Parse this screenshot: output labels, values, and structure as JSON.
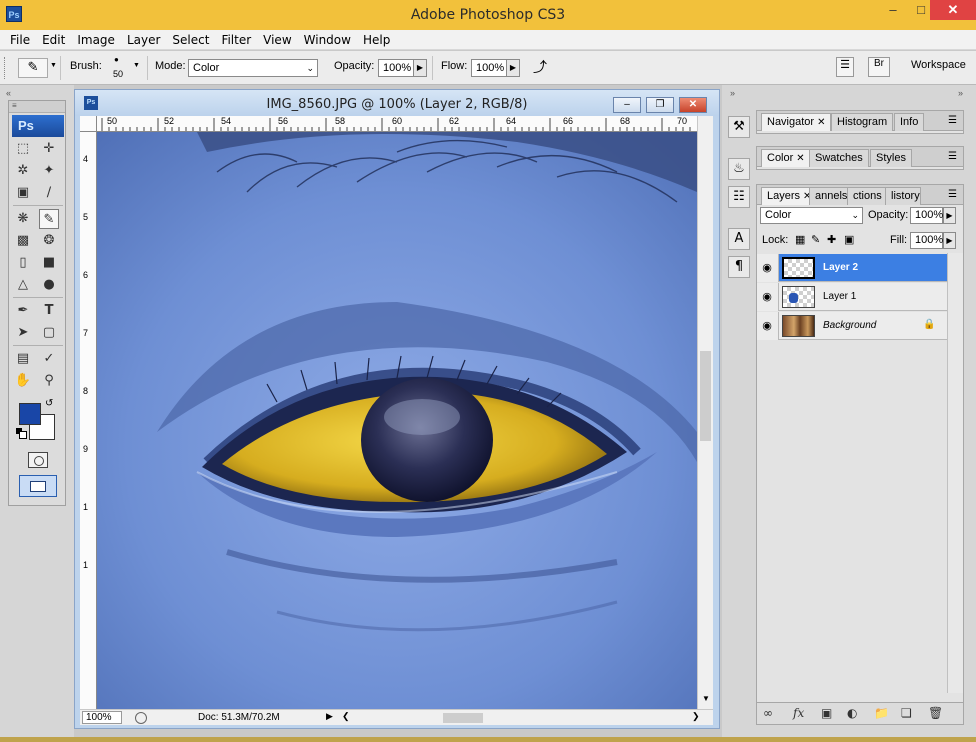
{
  "app": {
    "title": "Adobe Photoshop CS3",
    "logo": "Ps",
    "window_buttons": [
      "minimize-icon",
      "maximize-icon",
      "close-icon"
    ]
  },
  "menu": [
    "File",
    "Edit",
    "Image",
    "Layer",
    "Select",
    "Filter",
    "View",
    "Window",
    "Help"
  ],
  "options_bar": {
    "brush_label": "Brush:",
    "brush_size": "50",
    "mode_label": "Mode:",
    "mode_value": "Color",
    "opacity_label": "Opacity:",
    "opacity_value": "100%",
    "flow_label": "Flow:",
    "flow_value": "100%",
    "workspace_label": "Workspace"
  },
  "toolbox": {
    "badge": "Ps",
    "foreground_color": "#1946a7",
    "background_color": "#ffffff",
    "active_tool": "brush-tool"
  },
  "document": {
    "title": "IMG_8560.JPG @ 100% (Layer 2, RGB/8)",
    "zoom": "100%",
    "doc_info": "Doc: 51.3M/70.2M",
    "ruler_top": [
      "50",
      "52",
      "54",
      "56",
      "58",
      "60",
      "62",
      "64",
      "66",
      "68",
      "70"
    ],
    "ruler_left": [
      "4",
      "5",
      "6",
      "7",
      "8",
      "9",
      "1",
      "1"
    ]
  },
  "panels": {
    "group1_tabs": [
      "Navigator",
      "Histogram",
      "Info"
    ],
    "group2_tabs": [
      "Color",
      "Swatches",
      "Styles"
    ],
    "group3_tabs": [
      "Layers",
      "annels",
      "ctions",
      "listory"
    ],
    "blend_mode": "Color",
    "opacity_label": "Opacity:",
    "opacity_value": "100%",
    "lock_label": "Lock:",
    "fill_label": "Fill:",
    "fill_value": "100%",
    "layers": [
      {
        "name": "Layer 2",
        "selected": true
      },
      {
        "name": "Layer 1",
        "selected": false
      },
      {
        "name": "Background",
        "selected": false
      }
    ]
  },
  "colors": {
    "titlebar": "#f2c13b",
    "selection": "#3c7fe3",
    "iris_yellow": "#e8c52b",
    "skin_blue": "#7090d4"
  }
}
